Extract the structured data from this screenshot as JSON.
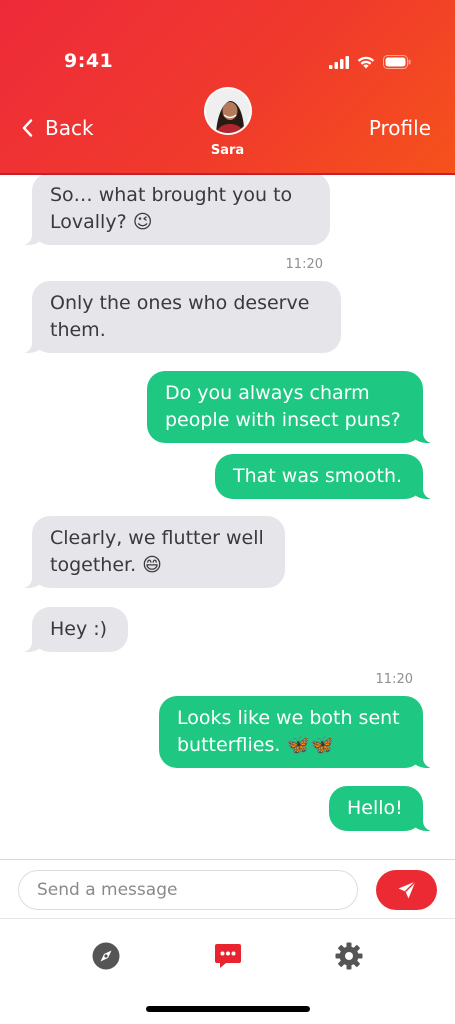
{
  "status_bar": {
    "time": "9:41"
  },
  "header": {
    "back_label": "Back",
    "profile_label": "Profile",
    "contact_name": "Sara",
    "color_start": "#ee2a3a",
    "color_end": "#f6521c"
  },
  "messages": [
    {
      "direction": "in",
      "text": "So… what brought you to Lovally? 😉"
    },
    {
      "timestamp": "11:20"
    },
    {
      "direction": "in",
      "text": "Only the ones who deserve them."
    },
    {
      "direction": "out",
      "text": "Do you always charm people with insect puns?"
    },
    {
      "direction": "out",
      "text": "That was smooth."
    },
    {
      "direction": "in",
      "text": "Clearly, we flutter well together. 😄"
    },
    {
      "direction": "in",
      "text": "Hey :)"
    },
    {
      "timestamp": "11:20"
    },
    {
      "direction": "out",
      "text": "Looks like we both sent butterflies. 🦋🦋"
    },
    {
      "direction": "out",
      "text": "Hello!"
    }
  ],
  "composer": {
    "placeholder": "Send a message",
    "send_icon": "paper-plane-icon",
    "accent": "#ec2a33"
  },
  "tabbar": {
    "items": [
      {
        "icon": "compass-icon",
        "active": false
      },
      {
        "icon": "chat-bubble-icon",
        "active": true
      },
      {
        "icon": "gear-icon",
        "active": false
      }
    ],
    "active_color": "#e8252f",
    "inactive_color": "#555555"
  },
  "colors": {
    "incoming_bubble": "#e5e5ea",
    "outgoing_bubble": "#1fc882"
  }
}
